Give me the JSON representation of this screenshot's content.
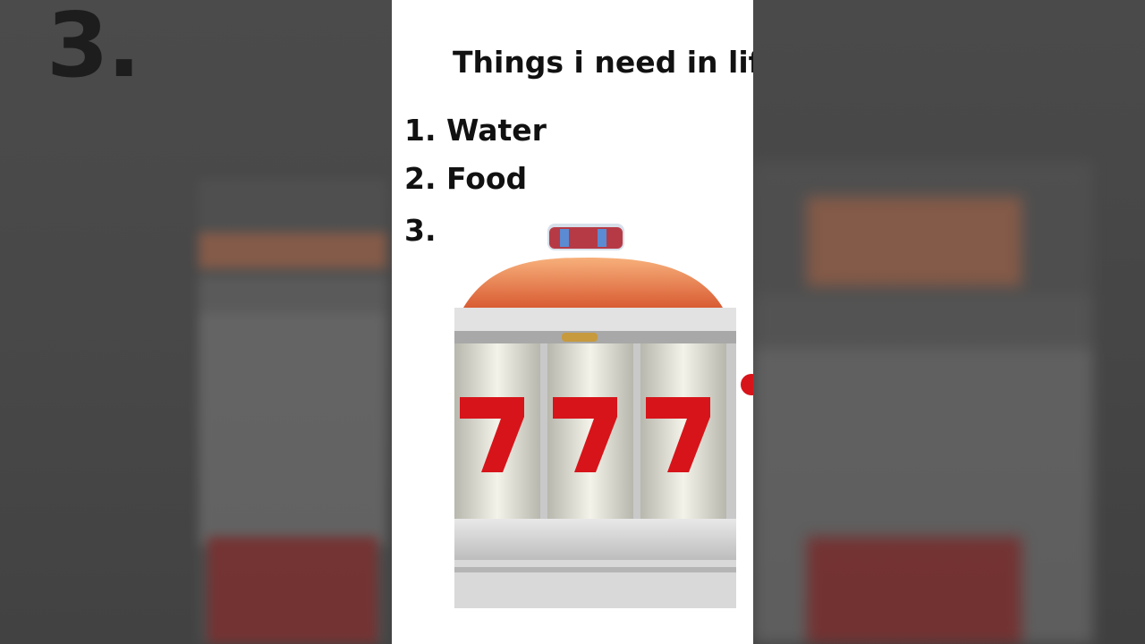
{
  "background": {
    "number": "3."
  },
  "panel": {
    "title": "Things i need in life:",
    "items": [
      {
        "label": "1. Water"
      },
      {
        "label": "2. Food"
      },
      {
        "label": "3."
      }
    ]
  },
  "image": {
    "name": "slot-machine-777",
    "reel_symbols": [
      "7",
      "7",
      "7"
    ],
    "colors": {
      "red": "#d7141a",
      "dome": "#e9875a",
      "silver": "#cfcfcf"
    }
  }
}
